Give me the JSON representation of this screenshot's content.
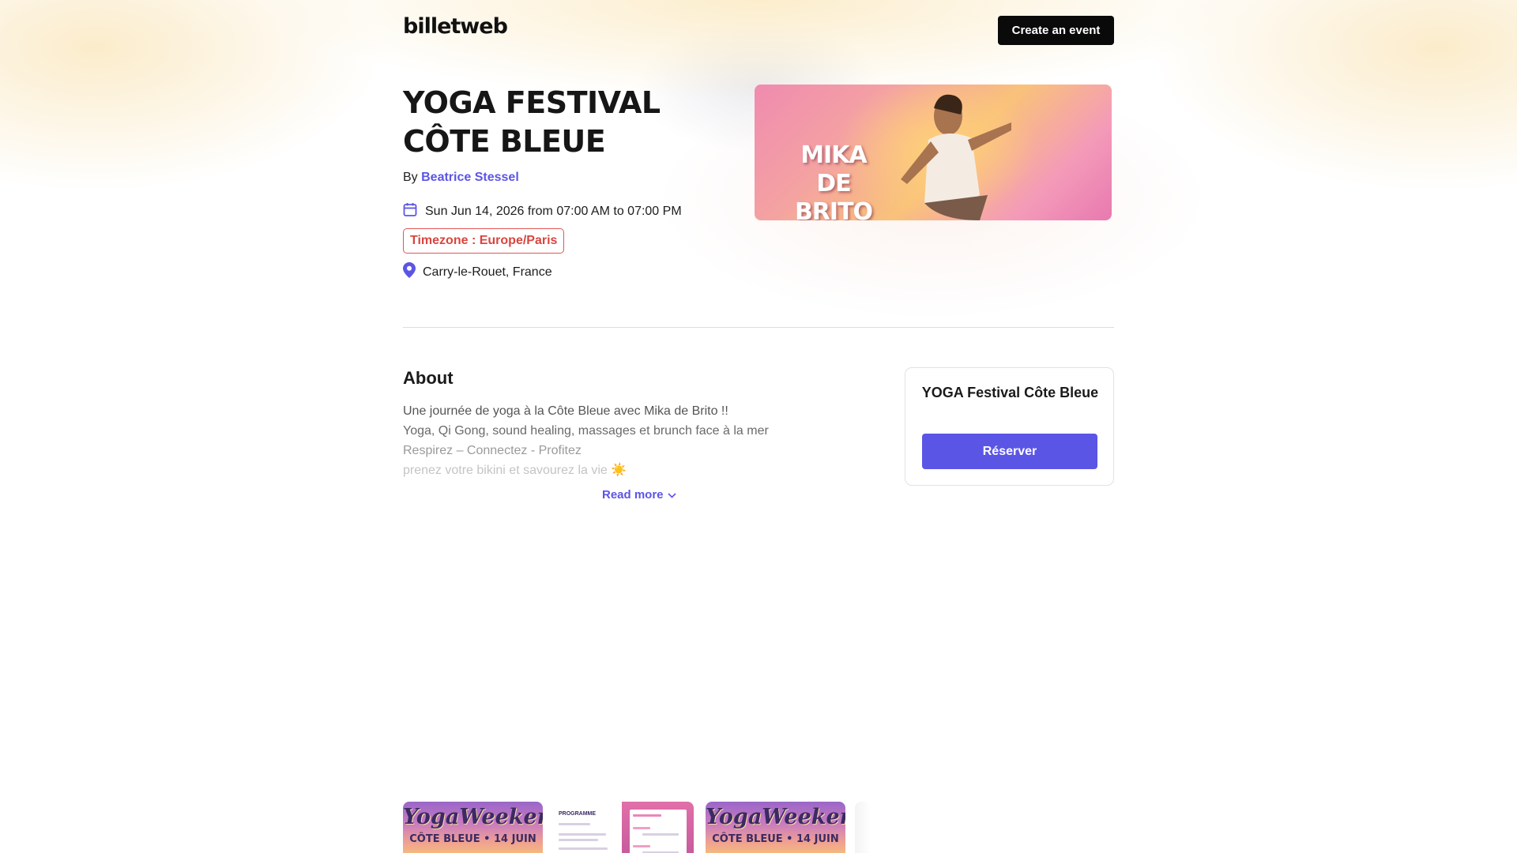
{
  "header": {
    "logo_text": "billetweb",
    "create_event_label": "Create an event"
  },
  "event": {
    "title_line1": "YOGA FESTIVAL",
    "title_line2": "CÔTE BLEUE",
    "by_prefix": "By",
    "organizer": "Beatrice Stessel",
    "date_text": "Sun Jun 14, 2026 from 07:00 AM to 07:00 PM",
    "timezone_label": "Timezone : Europe/Paris",
    "location": "Carry-le-Rouet, France",
    "banner_text_line1": "MIKA",
    "banner_text_line2": "DE BRITO"
  },
  "about": {
    "heading": "About",
    "lines": [
      "Une journée de yoga à la Côte Bleue avec Mika de Brito !!",
      "Yoga, Qi Gong, sound healing, massages et brunch face à la mer",
      "Respirez – Connectez - Profitez",
      " prenez votre bikini et savourez la vie ☀️"
    ],
    "read_more_label": "Read more"
  },
  "booking_card": {
    "title": "YOGA Festival Côte Bleue",
    "reserve_label": "Réserver"
  },
  "gallery": {
    "thumb1_title": "YogaWeekend",
    "thumb1_subtitle": "CÔTE BLEUE • 14 JUIN",
    "thumb2_title": "PROGRAMME",
    "thumb3_title": "YogaWeekend",
    "thumb3_subtitle": "CÔTE BLEUE • 14 JUIN"
  },
  "colors": {
    "accent": "#5b55e6",
    "timezone_red": "#d9453f",
    "dark_button": "#0a0a0a"
  }
}
